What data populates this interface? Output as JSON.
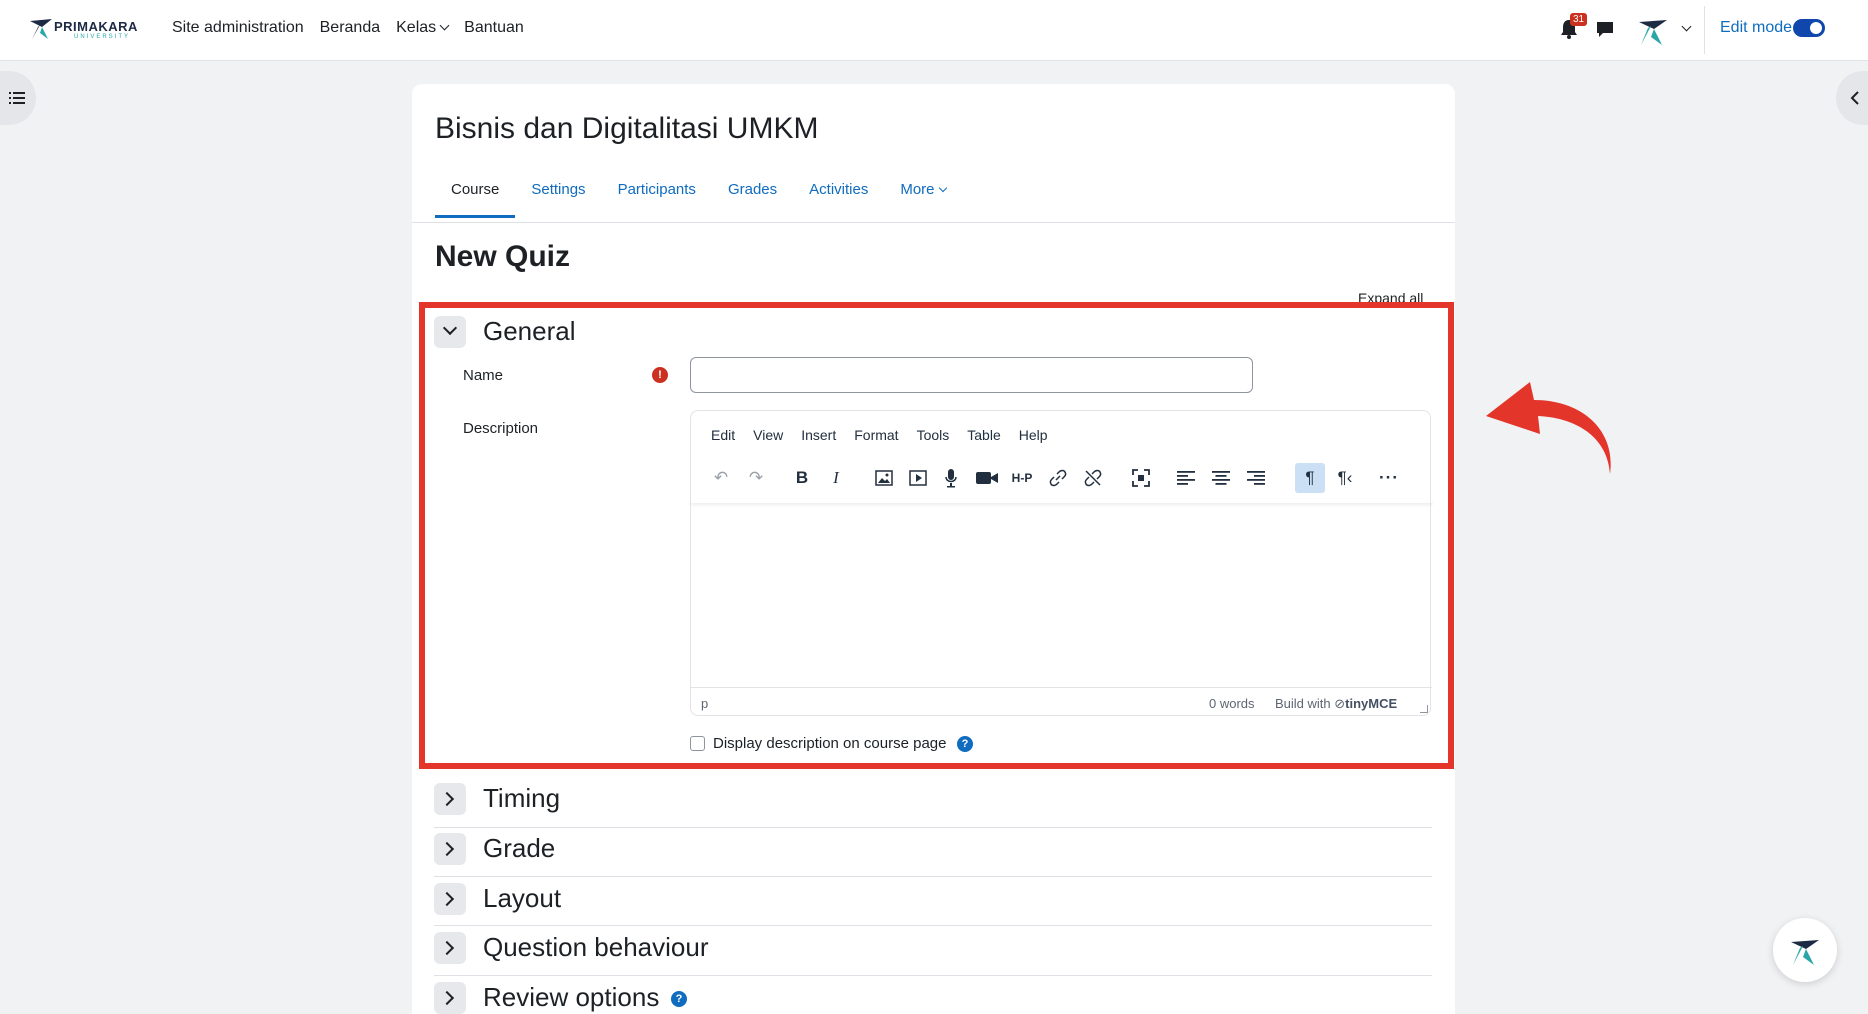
{
  "brand": {
    "name": "PRIMAKARA",
    "sub": "UNIVERSITY"
  },
  "nav": {
    "links": [
      "Site administration",
      "Beranda",
      "Kelas",
      "Bantuan"
    ],
    "notifications_count": "31",
    "edit_mode_label": "Edit mode"
  },
  "course": {
    "title": "Bisnis dan Digitalitasi UMKM",
    "tabs": [
      "Course",
      "Settings",
      "Participants",
      "Grades",
      "Activities",
      "More"
    ]
  },
  "page": {
    "title": "New Quiz",
    "expand_all": "Expand all"
  },
  "general": {
    "title": "General",
    "name_label": "Name",
    "name_value": "",
    "description_label": "Description",
    "editor_menu": [
      "Edit",
      "View",
      "Insert",
      "Format",
      "Tools",
      "Table",
      "Help"
    ],
    "status_path": "p",
    "word_count": "0 words",
    "build_with": "Build with",
    "tiny_brand": "tinyMCE",
    "display_desc_label": "Display description on course page"
  },
  "sections": [
    "Timing",
    "Grade",
    "Layout",
    "Question behaviour",
    "Review options"
  ],
  "colors": {
    "accent": "#0f6cbf",
    "highlight": "#e3352a",
    "required": "#ca3120"
  }
}
